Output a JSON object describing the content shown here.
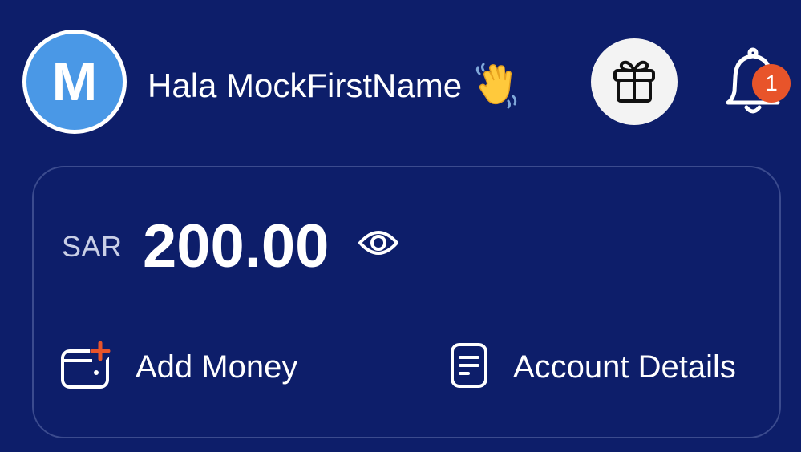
{
  "user": {
    "avatar_initial": "M",
    "greeting": "Hala MockFirstName"
  },
  "icons": {
    "wave": "waving-hand-icon",
    "gift": "gift-icon",
    "bell": "bell-icon",
    "eye": "eye-icon",
    "wallet_add": "wallet-add-icon",
    "document": "document-icon"
  },
  "notifications": {
    "count": "1"
  },
  "balance": {
    "currency": "SAR",
    "amount": "200.00"
  },
  "actions": {
    "add_money": "Add Money",
    "account_details": "Account Details"
  },
  "colors": {
    "background": "#0d1e6a",
    "avatar": "#4a98e6",
    "badge": "#e8542a",
    "gift_button": "#f3f3f3",
    "card_border": "#3b4b8e",
    "accent_plus": "#e8542a"
  }
}
